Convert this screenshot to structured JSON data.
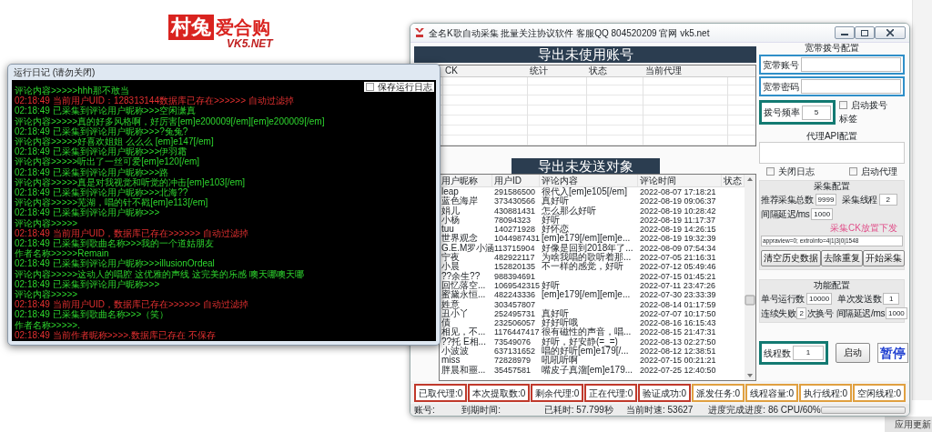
{
  "logo": {
    "brand": "村兔",
    "name": "爱合购",
    "site": "VK5.NET"
  },
  "main_window": {
    "title": "全名K歌自动采集 批量关注协议软件 客服QQ 804520209 官网 vk5.net",
    "accounts_export_button": "导出未使用账号",
    "accounts_table": {
      "columns": [
        "CK",
        "统计",
        "状态",
        "当前代理"
      ]
    },
    "targets_export_button": "导出未发送对象",
    "targets_table": {
      "columns": [
        "用户昵称",
        "用户ID",
        "评论内容",
        "评论时间",
        "状态"
      ],
      "rows": [
        {
          "nickname": "leap",
          "user_id": "291586500",
          "comment": "很代入[em]e105[/em]",
          "time": "2022-08-07 17:18:21"
        },
        {
          "nickname": "蓝色海岸",
          "user_id": "373430566",
          "comment": "真好听",
          "time": "2022-08-19 09:06:37"
        },
        {
          "nickname": "娟儿",
          "user_id": "430881431",
          "comment": "怎么那么好听",
          "time": "2022-08-19 10:28:42"
        },
        {
          "nickname": "小杨",
          "user_id": "78094323",
          "comment": "好听",
          "time": "2022-08-19 11:17:37"
        },
        {
          "nickname": "tuu",
          "user_id": "140271928",
          "comment": "好怀恋",
          "time": "2022-08-19 14:26:15"
        },
        {
          "nickname": "世界观念",
          "user_id": "1044987431",
          "comment": "[em]e179[/em][em]e...",
          "time": "2022-08-19 19:32:39"
        },
        {
          "nickname": "G.E.M罗小涵",
          "user_id": "113715904",
          "comment": "好像是回到2018年了...",
          "time": "2022-08-09 07:54:34"
        },
        {
          "nickname": "宁夜",
          "user_id": "482922117",
          "comment": "为啥我唱的歌听着那...",
          "time": "2022-07-05 21:16:31"
        },
        {
          "nickname": "小晨",
          "user_id": "152820135",
          "comment": "不一样的感觉，好听",
          "time": "2022-07-12 05:49:46"
        },
        {
          "nickname": "??余生??",
          "user_id": "988394691",
          "time": "2022-07-15 01:45:21"
        },
        {
          "nickname": "回忆落空...",
          "user_id": "1069542315",
          "comment": "好听",
          "time": "2022-07-11 23:47:26"
        },
        {
          "nickname": "蜜黛永恒...",
          "user_id": "482243336",
          "comment": "[em]e179[/em][em]e...",
          "time": "2022-07-30 23:33:39"
        },
        {
          "nickname": "姓意",
          "user_id": "303457807",
          "time": "2022-08-14 01:17:59"
        },
        {
          "nickname": "丑小丫",
          "user_id": "252495731",
          "comment": "真好听",
          "time": "2022-07-07 10:17:50"
        },
        {
          "nickname": "債",
          "user_id": "232506057",
          "comment": "好好听哦",
          "time": "2022-08-16 16:15:43"
        },
        {
          "nickname": "相见，不...",
          "user_id": "1176447417",
          "comment": "很有磁性的声音，唱...",
          "time": "2022-08-15 21:47:31"
        },
        {
          "nickname": "??托 E相...",
          "user_id": "73549076",
          "comment": "好听，好安静(=_=)",
          "time": "2022-08-13 02:27:50"
        },
        {
          "nickname": "小波波",
          "user_id": "637131652",
          "comment": "唱的好听[em]e179[/...",
          "time": "2022-08-12 12:38:51"
        },
        {
          "nickname": "miss",
          "user_id": "72828979",
          "comment": "吼吼听啊",
          "time": "2022-07-15 00:21:21"
        },
        {
          "nickname": "胖晨和噩...",
          "user_id": "35457581",
          "comment": "嘴皮子真溜[em]e179...",
          "time": "2022-07-25 12:40:50"
        }
      ]
    },
    "dial_config": {
      "title": "宽带拨号配置",
      "account_label": "宽带账号",
      "password_label": "宽带密码",
      "frequency_label": "拨号频率",
      "frequency": "5",
      "auto_dial": {
        "label": "启动拨号",
        "checked": false
      },
      "tag_label": "标签"
    },
    "proxy_config": {
      "title": "代理API配置",
      "close_log": {
        "label": "关闭日志",
        "checked": false
      },
      "start_proxy": {
        "label": "启动代理",
        "checked": false
      }
    },
    "collect_config": {
      "title": "采集配置",
      "total_label": "推荐采集总数",
      "total": "9999",
      "threads_label": "采集线程",
      "threads": "2",
      "delay_label": "间隔延迟/ms",
      "delay": "1000",
      "ck_hint": "采集CK放置下发",
      "ck_value": "appraview=0; extroInfo=4|1|3|0|1548",
      "buttons": [
        "清空历史数据",
        "去除重复",
        "开始采集"
      ]
    },
    "function_config": {
      "title": "功能配置",
      "runs_label": "单号运行数",
      "runs": "10000",
      "sends_label": "单次发送数",
      "sends": "1",
      "fail_label": "连续失败",
      "fail": "2",
      "switch_label": "次换号",
      "delay_label": "间隔延迟/ms",
      "delay": "1000"
    },
    "run_controls": {
      "thread_label": "线程数",
      "thread_count": "1",
      "start_button": "启动",
      "pause_button": "暂停"
    },
    "counters": [
      {
        "label": "已取代理:0",
        "color": "#c0392b"
      },
      {
        "label": "本次提取数:0",
        "color": "#c0392b"
      },
      {
        "label": "剩余代理:0",
        "color": "#c0392b"
      },
      {
        "label": "正在代理:0",
        "color": "#c0392b"
      },
      {
        "label": "验证成功:0",
        "color": "#c0392b"
      },
      {
        "label": "派发任务:0",
        "color": "#e0a040"
      },
      {
        "label": "线程容量:0",
        "color": "#e0a040"
      },
      {
        "label": "执行线程:0",
        "color": "#e0a040"
      },
      {
        "label": "空闲线程:0",
        "color": "#e0a040"
      }
    ],
    "status_bar": {
      "items": [
        "账号:",
        "到期时间:",
        "已耗时: 57.799秒",
        "当前时速: 53627",
        "进度完成进度: 86 CPU/60%"
      ],
      "progress": {
        "level": 0
      }
    }
  },
  "log_window": {
    "title": "运行日记 (请勿关闭)",
    "save_log": {
      "label": "保存运行日志",
      "checked": false
    },
    "lines": [
      {
        "kind": "info",
        "text": "评论内容>>>>>hhh那不敢当"
      },
      {
        "kind": "warn",
        "text": "02:18:49 当前用户UID：128313144数据库已存在>>>>>>  自动过滤掉"
      },
      {
        "kind": "info",
        "text": "02:18:49 已采集到评论用户昵称>>>空闲潇真"
      },
      {
        "kind": "info",
        "text": "评论内容>>>>>真的好多风格啊，好厉害[em]e200009[/em][em]e200009[/em]"
      },
      {
        "kind": "info",
        "text": "02:18:49 已采集到评论用户昵称>>>?兔兔?"
      },
      {
        "kind": "info",
        "text": "评论内容>>>>>好喜欢姐姐 么么么 [em]e147[/em]"
      },
      {
        "kind": "info",
        "text": "02:18:49 已采集到评论用户昵称>>>伊羽霜"
      },
      {
        "kind": "info",
        "text": "评论内容>>>>>听出了一丝可爱[em]e120[/em]"
      },
      {
        "kind": "info",
        "text": "02:18:49 已采集到评论用户昵称>>>路"
      },
      {
        "kind": "info",
        "text": "评论内容>>>>>真是对我视觉和听觉的冲击[em]e103[/em]"
      },
      {
        "kind": "info",
        "text": "02:18:49 已采集到评论用户昵称>>>北海??"
      },
      {
        "kind": "info",
        "text": "评论内容>>>>>芜湖，唱的针不戳[em]e113[/em]"
      },
      {
        "kind": "info",
        "text": "02:18:49 已采集到评论用户昵称>>>"
      },
      {
        "kind": "info",
        "text": "评论内容>>>>>"
      },
      {
        "kind": "warn",
        "text": "02:18:49 当前用户UID，数据库已存在>>>>>>  自动过滤掉"
      },
      {
        "kind": "info",
        "text": "02:18:49 已采集到歌曲名称>>>我的一个道姑朋友"
      },
      {
        "kind": "info",
        "text": "作者名称>>>>>Remain"
      },
      {
        "kind": "info",
        "text": "02:18:49 已采集到评论用户昵称>>>illusionOrdeal"
      },
      {
        "kind": "info",
        "text": "评论内容>>>>>这动人的唱腔 这优雅的声线 这完美的乐感 噢天哪噢天哪"
      },
      {
        "kind": "info",
        "text": "02:18:49 已采集到评论用户昵称>>>"
      },
      {
        "kind": "info",
        "text": "评论内容>>>>>"
      },
      {
        "kind": "warn",
        "text": "02:18:49 当前用户UID，数据库已存在>>>>>>  自动过滤掉"
      },
      {
        "kind": "info",
        "text": "02:18:49 已采集到歌曲名称>>>（笑）"
      },
      {
        "kind": "info",
        "text": "作者名称>>>>>."
      },
      {
        "kind": "warn",
        "text": "02:18:49 当前作者昵称>>>>.数据库已存在 不保存"
      }
    ]
  },
  "side_panel": {
    "text": "应用更新"
  }
}
